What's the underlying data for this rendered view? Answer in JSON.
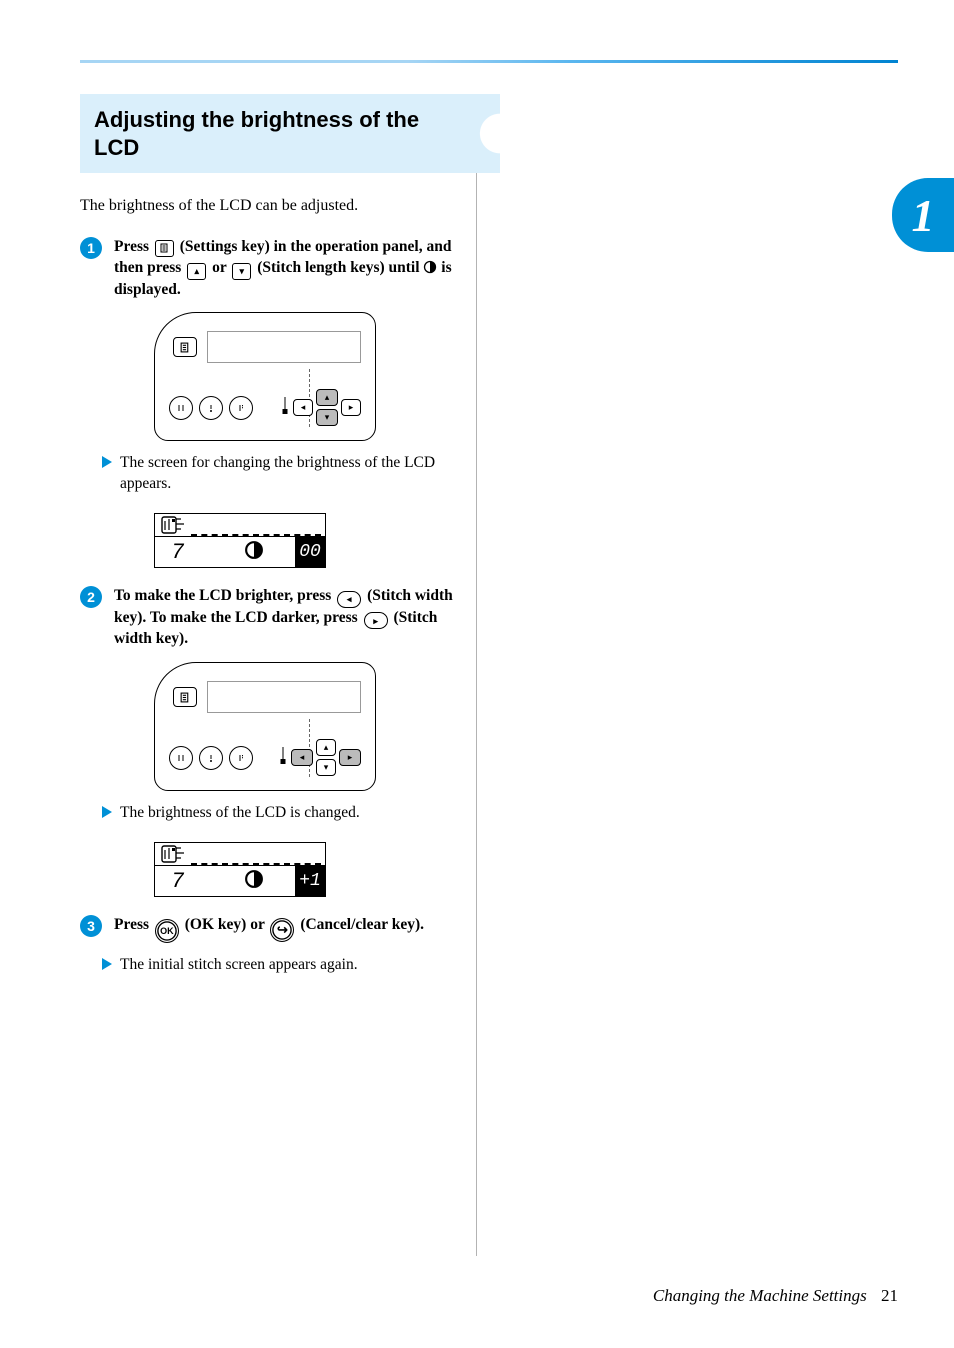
{
  "chapter_tab": "1",
  "heading": "Adjusting the brightness of the LCD",
  "intro": "The brightness of the LCD can be adjusted.",
  "steps": {
    "one": {
      "num": "1",
      "t1": "Press ",
      "t2": " (Settings key) in the operation panel, and then press ",
      "t3": " or ",
      "t4": " (Stitch length keys) until ",
      "t5": " is displayed."
    },
    "result1": "The screen for changing the brightness of the LCD appears.",
    "two": {
      "num": "2",
      "t1": "To make the LCD brighter, press ",
      "t2": " (Stitch width key). To make the LCD darker, press ",
      "t3": " (Stitch width key)."
    },
    "result2": "The brightness of the LCD is changed.",
    "three": {
      "num": "3",
      "t1": "Press ",
      "ok": "OK",
      "t2": " (OK key) or ",
      "t3": " (Cancel/clear key)."
    },
    "result3": "The initial stitch screen appears again."
  },
  "lcd_readouts": {
    "first": {
      "seg": "7",
      "tag": "00"
    },
    "second": {
      "seg": "7",
      "tag": "+1"
    }
  },
  "footer": {
    "section": "Changing the Machine Settings",
    "page": "21"
  }
}
